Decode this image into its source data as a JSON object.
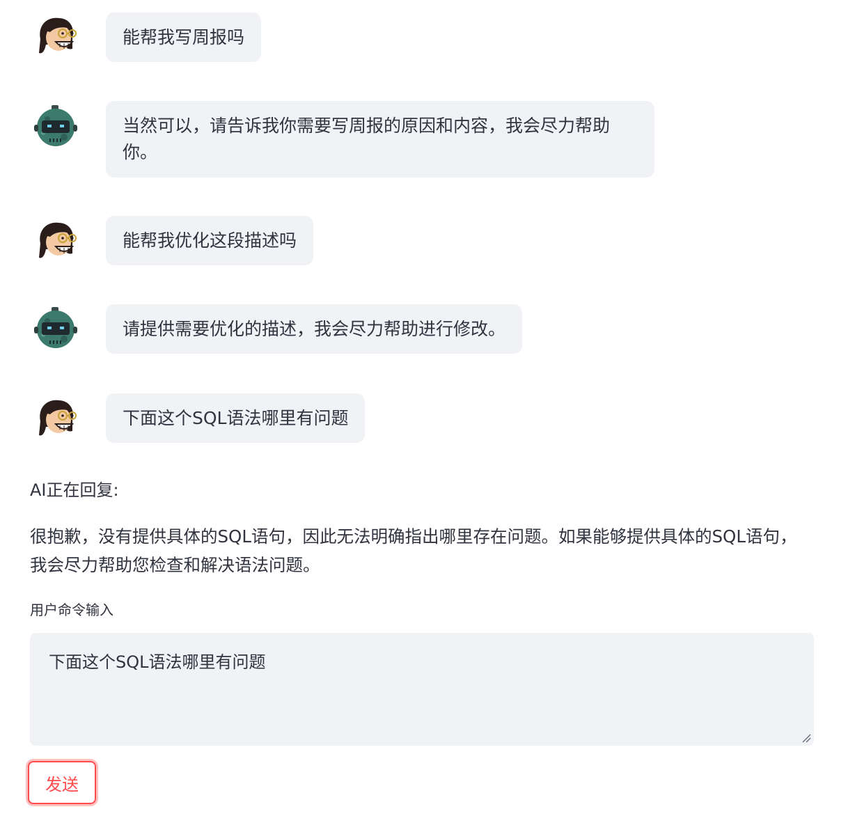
{
  "chat": {
    "messages": [
      {
        "role": "user",
        "avatar_icon": "user-avatar-icon",
        "text": "能帮我写周报吗"
      },
      {
        "role": "assistant",
        "avatar_icon": "robot-avatar-icon",
        "text": "当然可以，请告诉我你需要写周报的原因和内容，我会尽力帮助你。"
      },
      {
        "role": "user",
        "avatar_icon": "user-avatar-icon",
        "text": "能帮我优化这段描述吗"
      },
      {
        "role": "assistant",
        "avatar_icon": "robot-avatar-icon",
        "text": "请提供需要优化的描述，我会尽力帮助进行修改。"
      },
      {
        "role": "user",
        "avatar_icon": "user-avatar-icon",
        "text": "下面这个SQL语法哪里有问题"
      }
    ]
  },
  "response": {
    "label": "AI正在回复:",
    "text": "很抱歉，没有提供具体的SQL语句，因此无法明确指出哪里存在问题。如果能够提供具体的SQL语句，我会尽力帮助您检查和解决语法问题。"
  },
  "input": {
    "label": "用户命令输入",
    "value": "下面这个SQL语法哪里有问题"
  },
  "send_button": {
    "label": "发送"
  },
  "colors": {
    "bubble_bg": "#f0f2f6",
    "text": "#31333f",
    "accent": "#ff4b4b"
  }
}
